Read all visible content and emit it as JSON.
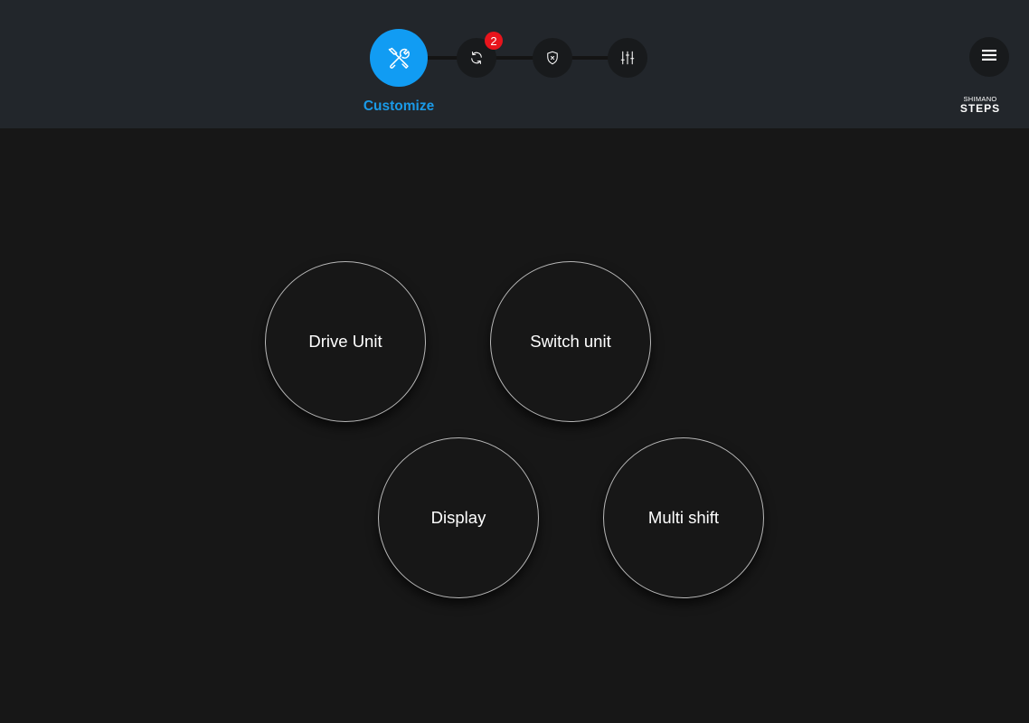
{
  "steps": [
    {
      "icon": "tools-icon",
      "label": "Customize",
      "active": true
    },
    {
      "icon": "sync-icon",
      "badge": "2"
    },
    {
      "icon": "shield-x-icon"
    },
    {
      "icon": "sliders-icon"
    }
  ],
  "header": {
    "menu_icon": "hamburger-icon",
    "logo": {
      "brand": "SHIMANO",
      "product": "STEPS"
    }
  },
  "units": [
    {
      "label": "Drive Unit"
    },
    {
      "label": "Switch unit"
    },
    {
      "label": "Display"
    },
    {
      "label": "Multi shift"
    }
  ],
  "colors": {
    "accent": "#119cf3",
    "accent_text": "#1a9ae8",
    "badge": "#e8141c",
    "header_bg": "#22262b",
    "page_bg": "#171717"
  }
}
